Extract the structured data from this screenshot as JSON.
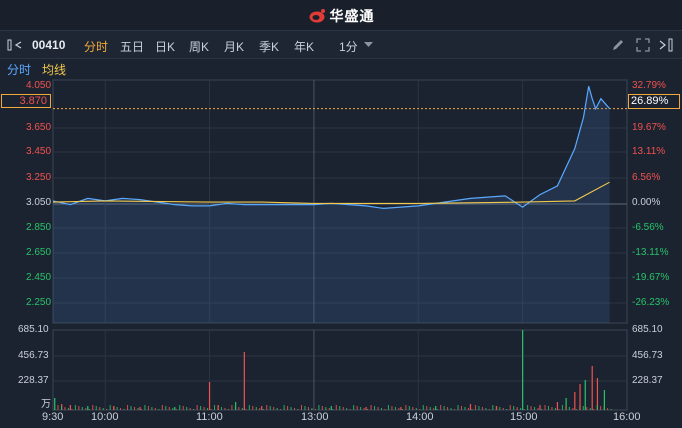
{
  "app": {
    "brand": "华盛通"
  },
  "toolbar": {
    "code": "00410",
    "tabs": [
      {
        "label": "分时",
        "active": true
      },
      {
        "label": "五日",
        "active": false
      },
      {
        "label": "日K",
        "active": false
      },
      {
        "label": "周K",
        "active": false
      },
      {
        "label": "月K",
        "active": false
      },
      {
        "label": "季K",
        "active": false
      },
      {
        "label": "年K",
        "active": false
      }
    ],
    "interval_label": "1分"
  },
  "indicators": {
    "minute": "分时",
    "avg": "均线"
  },
  "price_axis": {
    "left_labels": [
      "4.050",
      "3.650",
      "3.450",
      "3.250",
      "3.050",
      "2.850",
      "2.650",
      "2.450",
      "2.250"
    ],
    "right_labels": [
      "32.79%",
      "19.67%",
      "13.11%",
      "6.56%",
      "0.00%",
      "-6.56%",
      "-13.11%",
      "-19.67%",
      "-26.23%"
    ],
    "current_price": "3.870",
    "current_pct": "26.89%"
  },
  "volume_axis": {
    "labels": [
      "685.10",
      "456.73",
      "228.37"
    ],
    "unit": "万"
  },
  "time_axis": [
    "9:30",
    "10:00",
    "11:00",
    "13:00",
    "14:00",
    "15:00",
    "16:00"
  ],
  "colors": {
    "up": "#f0524d",
    "down": "#26c36a",
    "price_line": "#5aa9ff",
    "avg_line": "#f2c94c",
    "accent": "#f2a93b"
  },
  "chart_data": {
    "type": "line",
    "series": [
      {
        "name": "分时",
        "x": [
          "9:30",
          "9:40",
          "9:50",
          "10:00",
          "10:10",
          "10:20",
          "10:30",
          "10:40",
          "10:50",
          "11:00",
          "11:10",
          "11:20",
          "11:30",
          "13:00",
          "13:10",
          "13:20",
          "13:30",
          "13:40",
          "13:50",
          "14:00",
          "14:10",
          "14:20",
          "14:30",
          "14:40",
          "14:50",
          "15:00",
          "15:10",
          "15:20",
          "15:30",
          "15:35",
          "15:38",
          "15:40",
          "15:42",
          "15:45",
          "15:50"
        ],
        "values": [
          3.13,
          3.1,
          3.15,
          3.13,
          3.15,
          3.14,
          3.12,
          3.1,
          3.09,
          3.09,
          3.11,
          3.1,
          3.1,
          3.1,
          3.11,
          3.1,
          3.09,
          3.07,
          3.08,
          3.09,
          3.11,
          3.13,
          3.15,
          3.16,
          3.17,
          3.08,
          3.18,
          3.25,
          3.55,
          3.8,
          4.05,
          3.95,
          3.87,
          3.95,
          3.87
        ]
      },
      {
        "name": "均线",
        "x": [
          "9:30",
          "10:00",
          "11:00",
          "11:30",
          "13:00",
          "14:00",
          "15:00",
          "15:30",
          "15:50"
        ],
        "values": [
          3.12,
          3.13,
          3.12,
          3.12,
          3.11,
          3.11,
          3.12,
          3.13,
          3.28
        ]
      }
    ],
    "ylim": [
      2.15,
      4.1
    ]
  }
}
